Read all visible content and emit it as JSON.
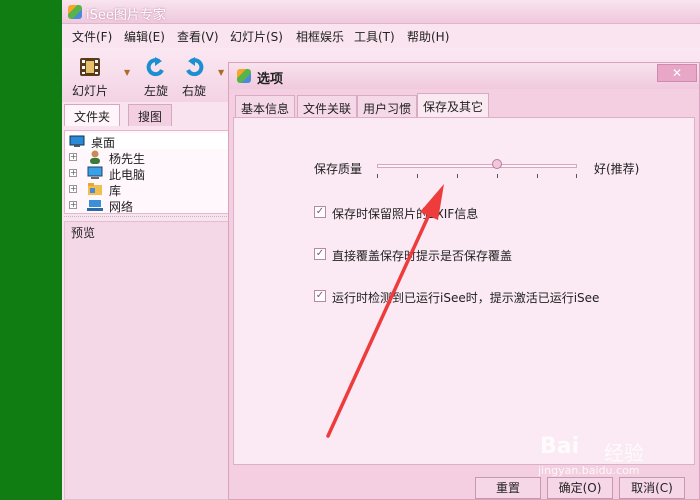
{
  "app": {
    "title": "iSee图片专家"
  },
  "menu": [
    "文件(F)",
    "编辑(E)",
    "查看(V)",
    "幻灯片(S)",
    "相框娱乐",
    "工具(T)",
    "帮助(H)"
  ],
  "toolbar": {
    "slideshow": "幻灯片",
    "rotate_left": "左旋",
    "rotate_right": "右旋"
  },
  "left_panel": {
    "tabs": [
      "文件夹",
      "搜图"
    ],
    "tree": [
      "桌面",
      "杨先生",
      "此电脑",
      "库",
      "网络"
    ],
    "preview_label": "预览"
  },
  "dialog": {
    "title": "选项",
    "close": "✕",
    "tabs": [
      "基本信息",
      "文件关联",
      "用户习惯",
      "保存及其它"
    ],
    "quality_label": "保存质量",
    "quality_value": 0.6,
    "quality_hint": "好(推荐)",
    "options": [
      {
        "label": "保存时保留照片的EXIF信息",
        "checked": true
      },
      {
        "label": "直接覆盖保存时提示是否保存覆盖",
        "checked": true
      },
      {
        "label": "运行时检测到已运行iSee时，提示激活已运行iSee",
        "checked": true
      }
    ],
    "buttons": {
      "reset": "重置",
      "ok": "确定(O)",
      "cancel": "取消(C)"
    }
  },
  "watermark": {
    "brand": "Bai",
    "brand2": "经验",
    "url": "jingyan.baidu.com"
  },
  "colors": {
    "accent_arrow": "#ee3b3b",
    "side_green": "#0f7d12",
    "theme_pink": "#f3cfe1"
  }
}
